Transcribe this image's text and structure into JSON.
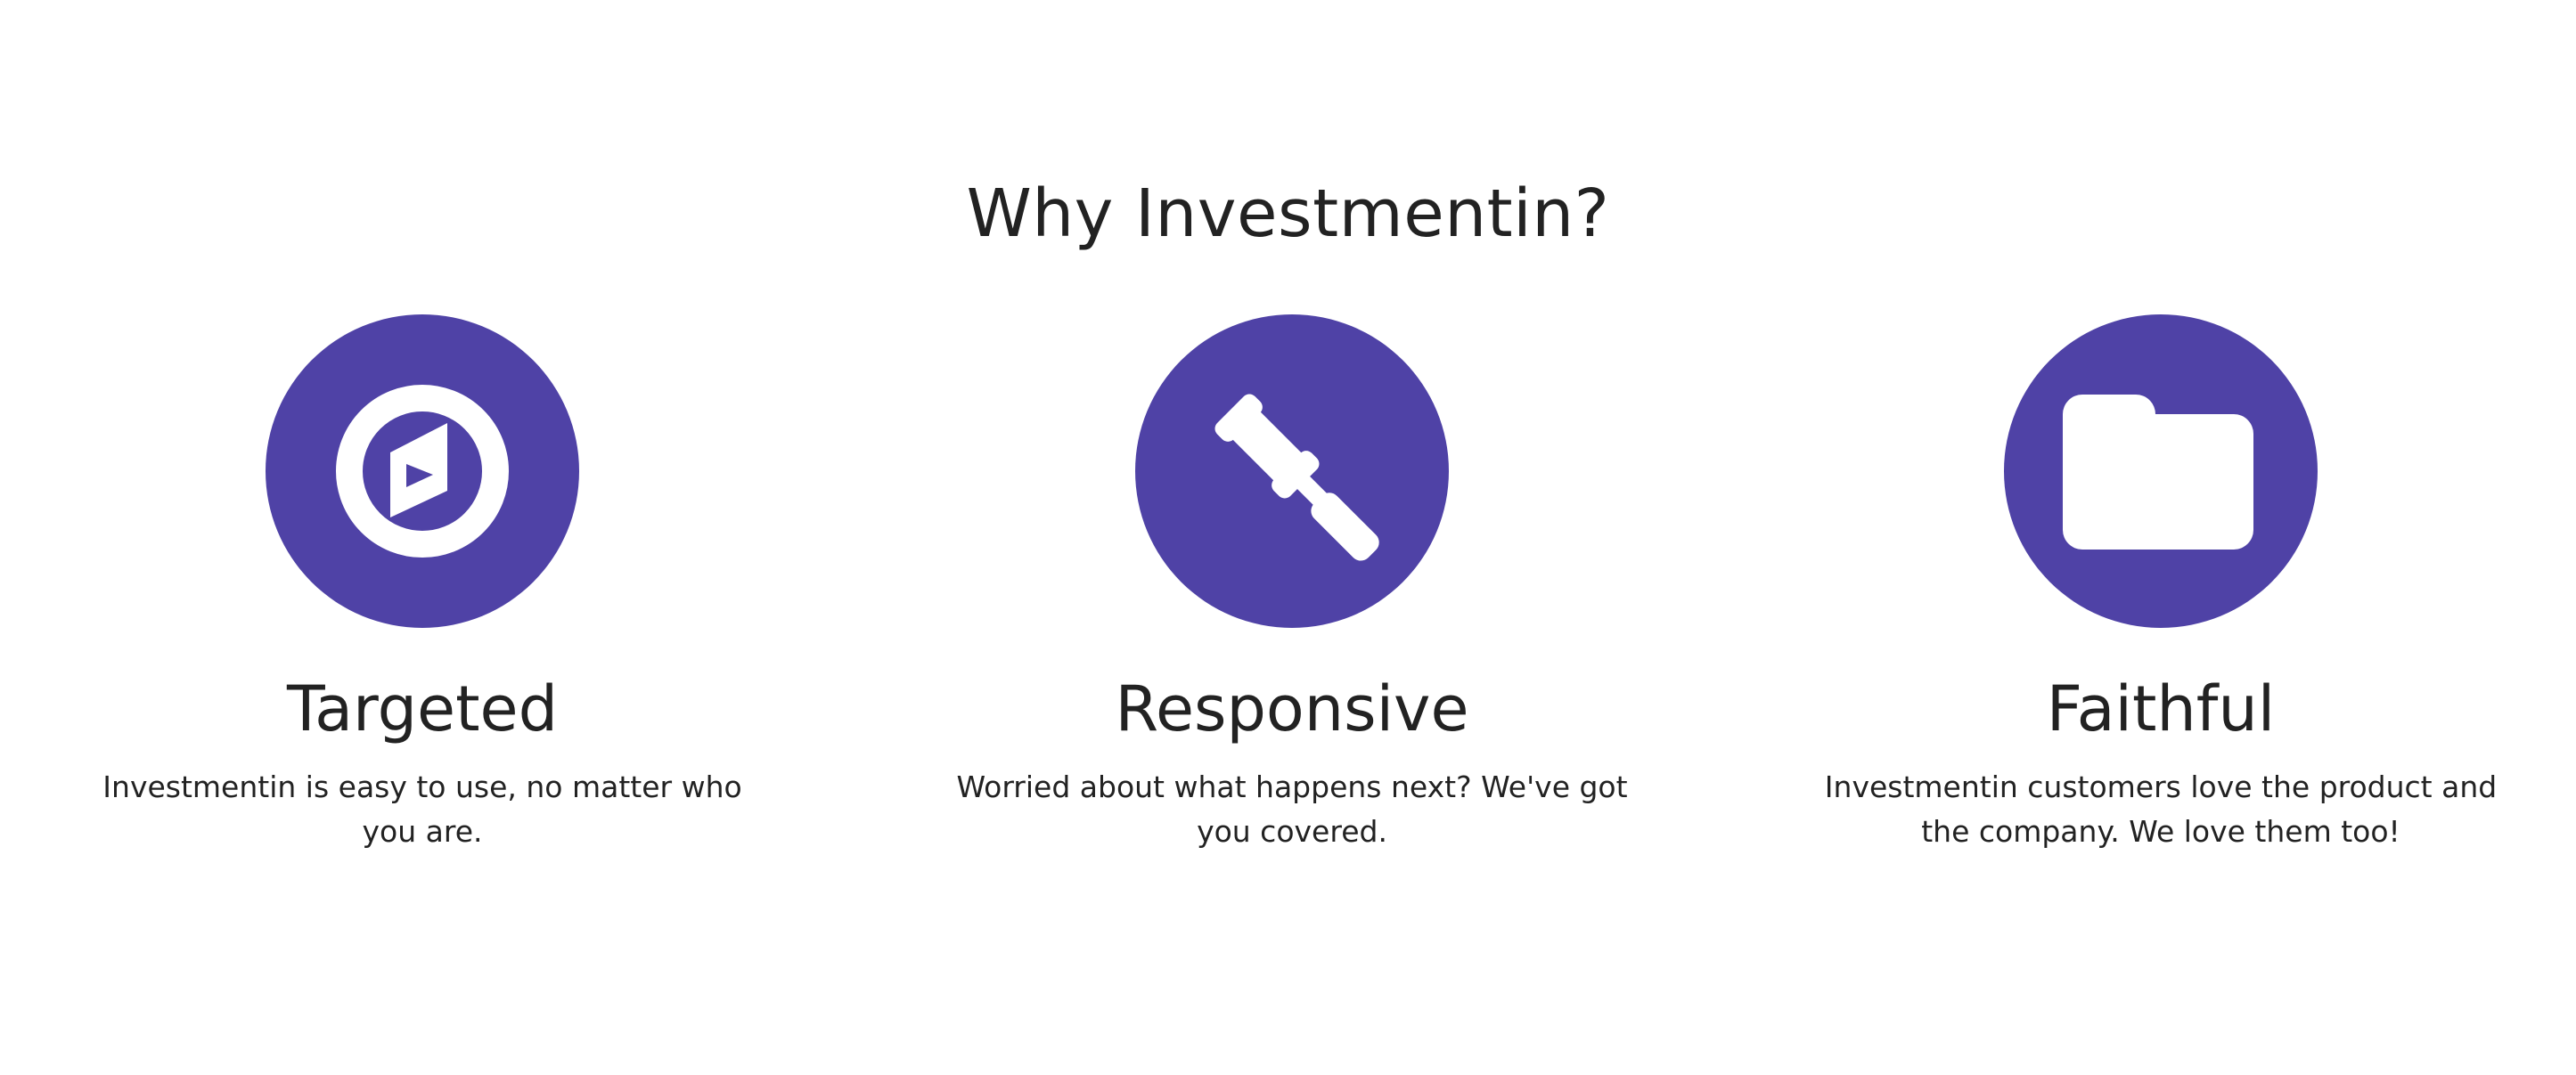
{
  "section": {
    "title": "Why Investmentin?"
  },
  "colors": {
    "accent": "#4f42a6",
    "text": "#222222",
    "background": "#ffffff"
  },
  "features": [
    {
      "icon": "target-play-icon",
      "title": "Targeted",
      "text": "Investmentin is easy to use, no matter who you are."
    },
    {
      "icon": "gavel-icon",
      "title": "Responsive",
      "text": "Worried about what happens next? We've got you covered."
    },
    {
      "icon": "folder-icon",
      "title": "Faithful",
      "text": "Investmentin customers love the product and the company. We love them too!"
    }
  ]
}
